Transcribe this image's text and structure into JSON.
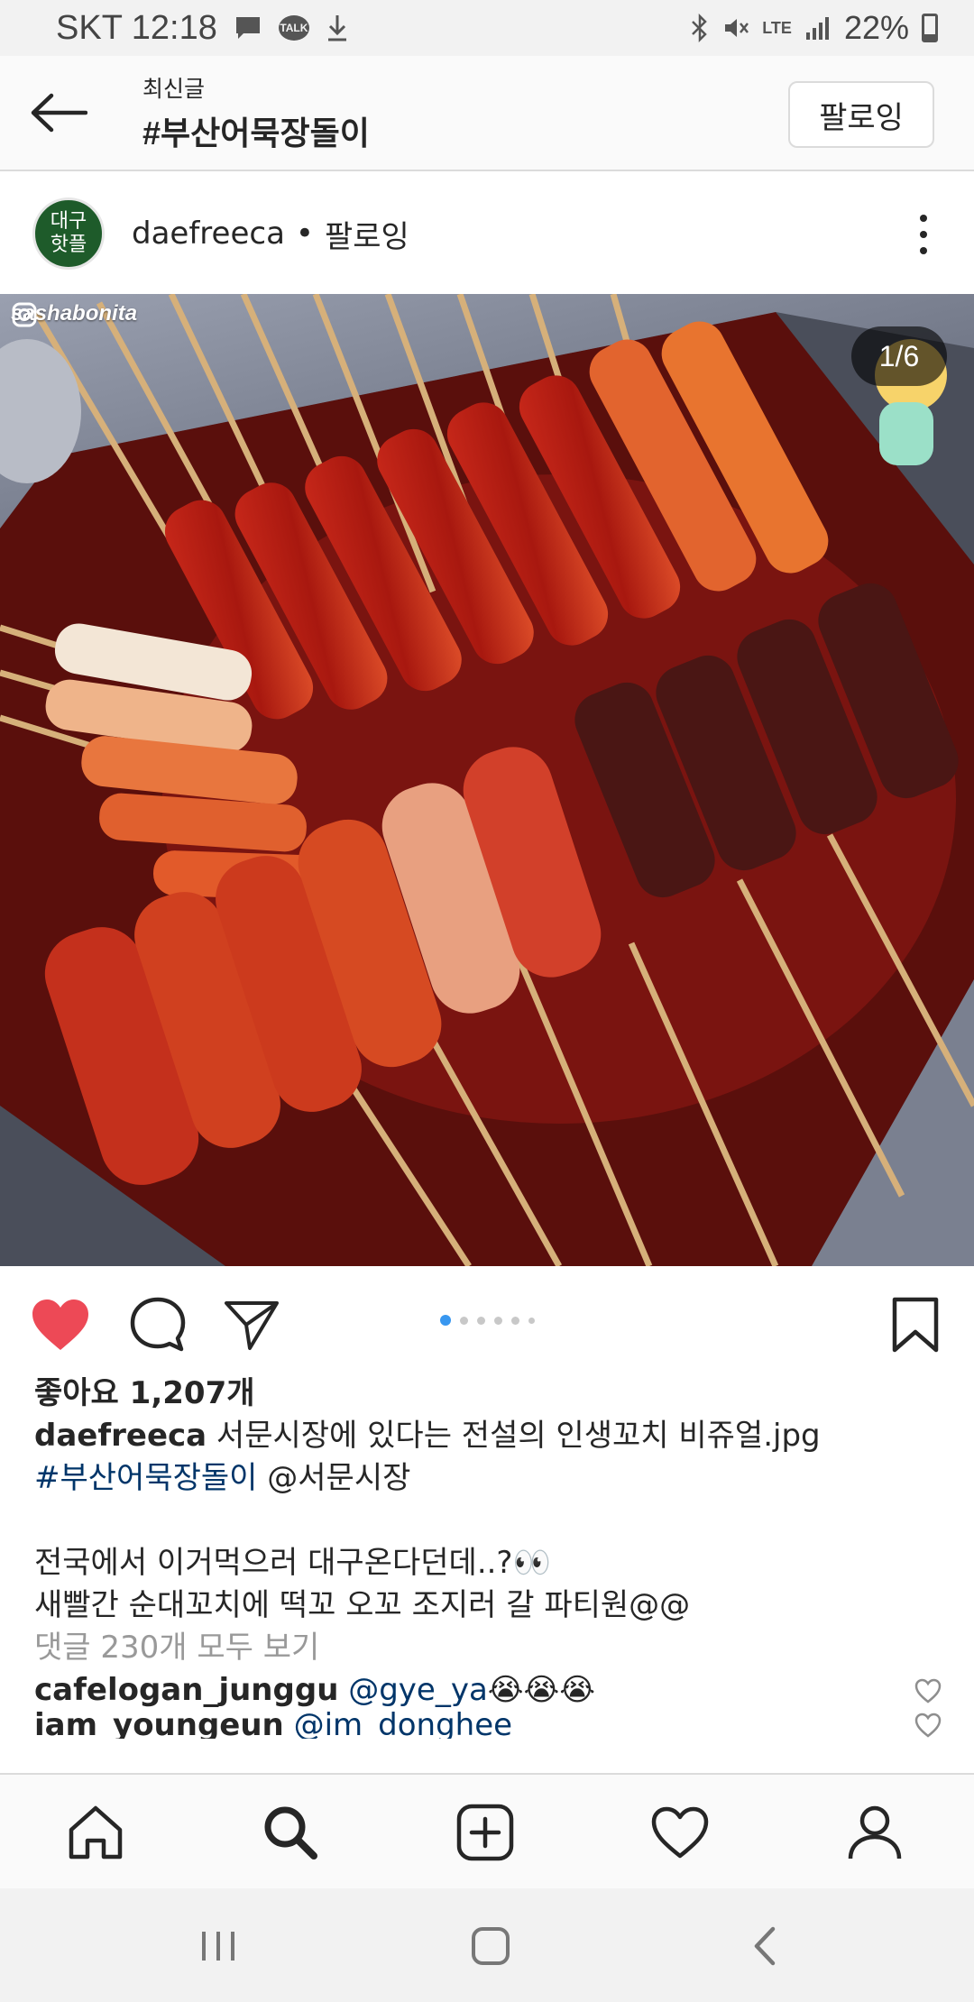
{
  "status_bar": {
    "carrier_time": "SKT 12:18",
    "talk_icon_text": "TALK",
    "network": "LTE",
    "battery": "22%",
    "icons": [
      "message-icon",
      "talk-icon",
      "download-icon",
      "bluetooth-icon",
      "mute-icon",
      "signal-icon",
      "battery-icon"
    ]
  },
  "top_bar": {
    "subtitle": "최신글",
    "title": "#부산어묵장돌이",
    "follow_label": "팔로잉"
  },
  "post": {
    "avatar_text_1": "대구",
    "avatar_text_2": "핫플",
    "username": "daefreeca",
    "separator": "•",
    "follow_status": "팔로잉",
    "image_watermark": "sashabonita",
    "image_counter": "1/6",
    "image_count": 6,
    "current_image": 1
  },
  "engagement": {
    "likes_text": "좋아요 1,207개",
    "liked": true,
    "heart_color": "#ed4956"
  },
  "caption": {
    "username": "daefreeca",
    "line1_text": " 서문시장에 있다는 전설의 인생꼬치 비쥬얼.jpg",
    "hashtag": "#부산어묵장돌이",
    "mention_location": " @서문시장",
    "line3": "전국에서 이거먹으러 대구온다던데..?👀",
    "line4": "새빨간 순대꼬치에 떡꼬 오꼬 조지러 갈 파티원@@"
  },
  "comments": {
    "view_all": "댓글 230개 모두 보기",
    "items": [
      {
        "user": "cafelogan_junggu",
        "mention": "@gye_ya",
        "text": " 😭😭😭"
      },
      {
        "user": "iam_youngeun",
        "mention": "@im_donghee",
        "text": ""
      }
    ]
  },
  "bottom_nav": {
    "items": [
      "home-icon",
      "search-icon",
      "add-post-icon",
      "activity-heart-icon",
      "profile-icon"
    ],
    "active": "search-icon"
  },
  "colors": {
    "link": "#003569",
    "accent": "#3897f0",
    "like": "#ed4956"
  }
}
